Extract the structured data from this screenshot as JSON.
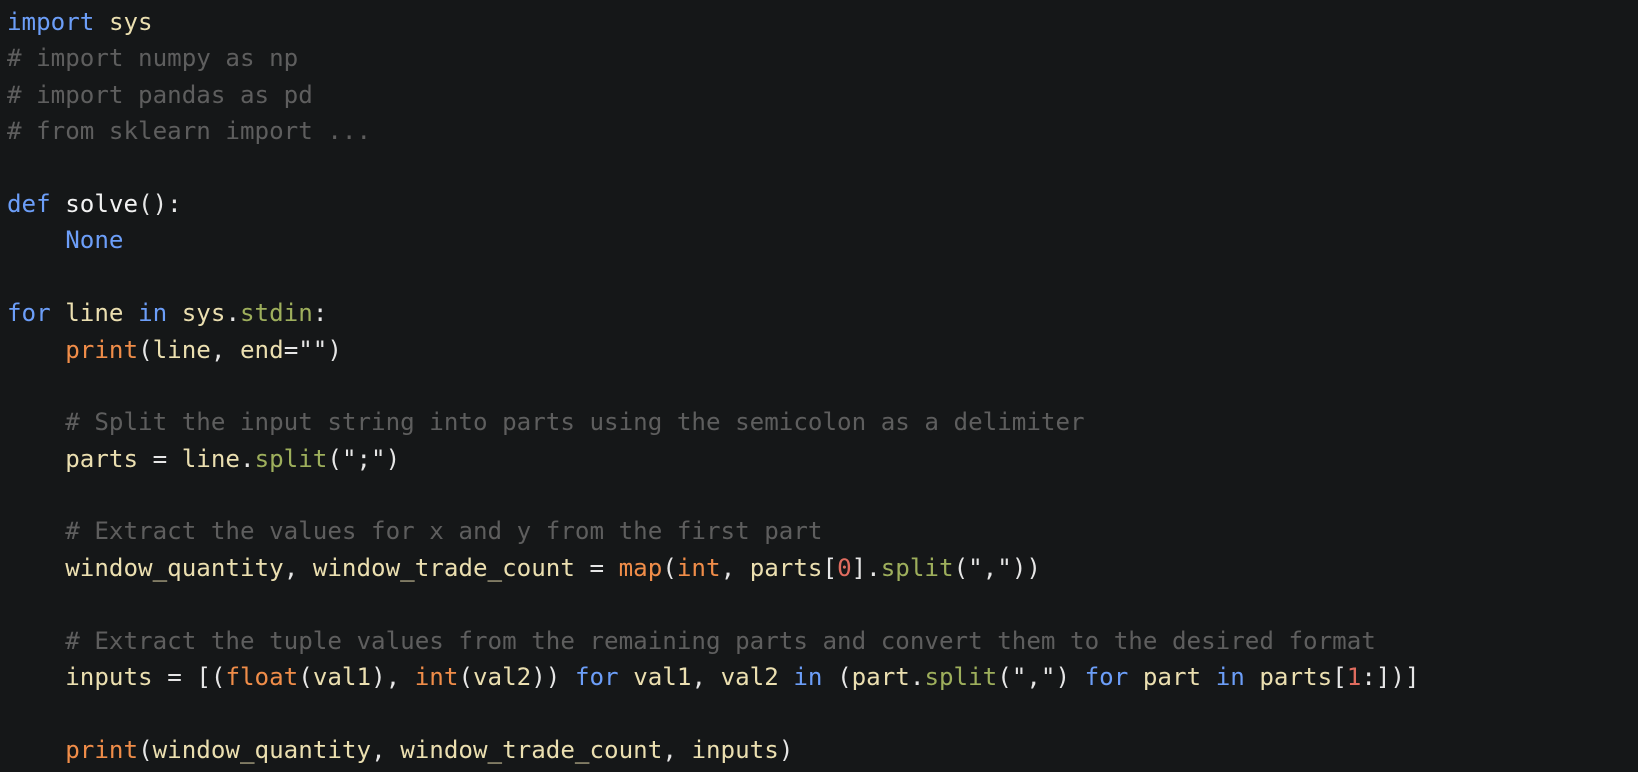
{
  "editor": {
    "language": "python",
    "theme": {
      "background": "#151718",
      "keyword": "#6c9ef8",
      "identifier": "#ebdfb0",
      "function_name": "#f2f2f2",
      "call": "#f08d49",
      "attribute": "#9eaf5c",
      "number": "#e06c5f",
      "comment": "#5e5e5e"
    },
    "cursor": {
      "line": 18,
      "after_token": "format"
    },
    "lines": [
      [
        [
          "kw",
          "import"
        ],
        [
          "sp",
          " "
        ],
        [
          "id",
          "sys"
        ]
      ],
      [
        [
          "cmt",
          "# import numpy as np"
        ]
      ],
      [
        [
          "cmt",
          "# import pandas as pd"
        ]
      ],
      [
        [
          "cmt",
          "# from sklearn import ..."
        ]
      ],
      [],
      [
        [
          "kw",
          "def"
        ],
        [
          "sp",
          " "
        ],
        [
          "fn",
          "solve"
        ],
        [
          "punc",
          "():"
        ]
      ],
      [
        [
          "sp",
          "    "
        ],
        [
          "kw",
          "None"
        ]
      ],
      [],
      [
        [
          "kw",
          "for"
        ],
        [
          "sp",
          " "
        ],
        [
          "id",
          "line"
        ],
        [
          "sp",
          " "
        ],
        [
          "kw",
          "in"
        ],
        [
          "sp",
          " "
        ],
        [
          "id",
          "sys"
        ],
        [
          "punc",
          "."
        ],
        [
          "attr",
          "stdin"
        ],
        [
          "punc",
          ":"
        ]
      ],
      [
        [
          "sp",
          "    "
        ],
        [
          "call",
          "print"
        ],
        [
          "punc",
          "("
        ],
        [
          "id",
          "line"
        ],
        [
          "punc",
          ", "
        ],
        [
          "id",
          "end"
        ],
        [
          "op",
          "="
        ],
        [
          "str",
          "\"\""
        ],
        [
          "punc",
          ")"
        ]
      ],
      [],
      [
        [
          "sp",
          "    "
        ],
        [
          "cmt",
          "# Split the input string into parts using the semicolon as a delimiter"
        ]
      ],
      [
        [
          "sp",
          "    "
        ],
        [
          "id",
          "parts"
        ],
        [
          "sp",
          " "
        ],
        [
          "op",
          "="
        ],
        [
          "sp",
          " "
        ],
        [
          "id",
          "line"
        ],
        [
          "punc",
          "."
        ],
        [
          "attr",
          "split"
        ],
        [
          "punc",
          "("
        ],
        [
          "str",
          "\";\""
        ],
        [
          "punc",
          ")"
        ]
      ],
      [],
      [
        [
          "sp",
          "    "
        ],
        [
          "cmt",
          "# Extract the values for x and y from the first part"
        ]
      ],
      [
        [
          "sp",
          "    "
        ],
        [
          "id",
          "window_quantity"
        ],
        [
          "punc",
          ", "
        ],
        [
          "id",
          "window_trade_count"
        ],
        [
          "sp",
          " "
        ],
        [
          "op",
          "="
        ],
        [
          "sp",
          " "
        ],
        [
          "call",
          "map"
        ],
        [
          "punc",
          "("
        ],
        [
          "call",
          "int"
        ],
        [
          "punc",
          ", "
        ],
        [
          "id",
          "parts"
        ],
        [
          "punc",
          "["
        ],
        [
          "num",
          "0"
        ],
        [
          "punc",
          "]."
        ],
        [
          "attr",
          "split"
        ],
        [
          "punc",
          "("
        ],
        [
          "str",
          "\",\""
        ],
        [
          "punc",
          "))"
        ]
      ],
      [],
      [
        [
          "sp",
          "    "
        ],
        [
          "cmt",
          "# Extract the tuple values from the remaining parts and convert them to the desired format"
        ]
      ],
      [
        [
          "sp",
          "    "
        ],
        [
          "id",
          "inputs"
        ],
        [
          "sp",
          " "
        ],
        [
          "op",
          "="
        ],
        [
          "sp",
          " "
        ],
        [
          "punc",
          "[("
        ],
        [
          "call",
          "float"
        ],
        [
          "punc",
          "("
        ],
        [
          "id",
          "val1"
        ],
        [
          "punc",
          "), "
        ],
        [
          "call",
          "int"
        ],
        [
          "punc",
          "("
        ],
        [
          "id",
          "val2"
        ],
        [
          "punc",
          "))"
        ],
        [
          "sp",
          " "
        ],
        [
          "kw",
          "for"
        ],
        [
          "sp",
          " "
        ],
        [
          "id",
          "val1"
        ],
        [
          "punc",
          ", "
        ],
        [
          "id",
          "val2"
        ],
        [
          "sp",
          " "
        ],
        [
          "kw",
          "in"
        ],
        [
          "sp",
          " "
        ],
        [
          "punc",
          "("
        ],
        [
          "id",
          "part"
        ],
        [
          "punc",
          "."
        ],
        [
          "attr",
          "split"
        ],
        [
          "punc",
          "("
        ],
        [
          "str",
          "\",\""
        ],
        [
          "punc",
          ")"
        ],
        [
          "sp",
          " "
        ],
        [
          "kw",
          "for"
        ],
        [
          "sp",
          " "
        ],
        [
          "id",
          "part"
        ],
        [
          "sp",
          " "
        ],
        [
          "kw",
          "in"
        ],
        [
          "sp",
          " "
        ],
        [
          "id",
          "parts"
        ],
        [
          "punc",
          "["
        ],
        [
          "num",
          "1"
        ],
        [
          "punc",
          ":])]"
        ]
      ],
      [],
      [
        [
          "sp",
          "    "
        ],
        [
          "call",
          "print"
        ],
        [
          "punc",
          "("
        ],
        [
          "id",
          "window_quantity"
        ],
        [
          "punc",
          ", "
        ],
        [
          "id",
          "window_trade_count"
        ],
        [
          "punc",
          ", "
        ],
        [
          "id",
          "inputs"
        ],
        [
          "punc",
          ")"
        ]
      ]
    ]
  }
}
